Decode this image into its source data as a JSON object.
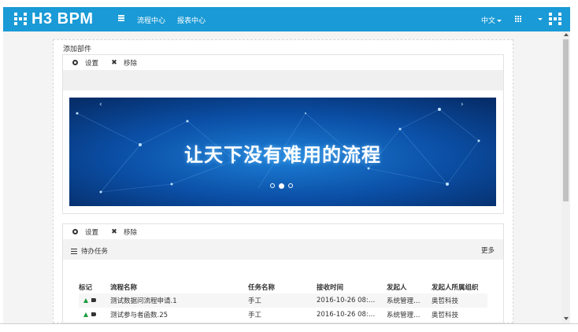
{
  "nav": {
    "logo": "H3 BPM",
    "links": [
      "流程中心",
      "报表中心"
    ],
    "language": "中文"
  },
  "page": {
    "add_widget": "添加部件"
  },
  "widget_banner": {
    "settings": "设置",
    "remove": "移除",
    "banner_text": "让天下没有难用的流程",
    "prev": "‹",
    "next": "›"
  },
  "widget_todo": {
    "settings": "设置",
    "remove": "移除",
    "title": "待办任务",
    "more": "更多",
    "columns": [
      "标记",
      "流程名称",
      "任务名称",
      "接收时间",
      "发起人",
      "发起人所属组织"
    ],
    "rows": [
      [
        "",
        "测试数据问流程申请.1",
        "手工",
        "2016-10-26 08:…",
        "系统管理…",
        "奥哲科技"
      ],
      [
        "",
        "测试参与者函数.25",
        "手工",
        "2016-10-26 08:…",
        "系统管理…",
        "奥哲科技"
      ]
    ]
  },
  "colors": {
    "nav_bg": "#1a9ad6",
    "banner_bg": "#0a3f8c",
    "flag_green": "#1a9a3a"
  },
  "icons": [
    "menu-icon",
    "apps-grid-icon",
    "user-icon",
    "gear-icon",
    "close-icon",
    "list-icon",
    "tree-icon",
    "horn-icon"
  ]
}
